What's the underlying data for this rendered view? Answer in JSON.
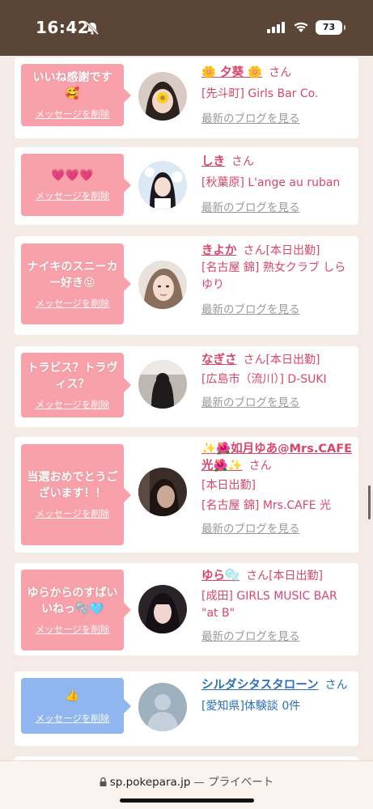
{
  "status_bar": {
    "time": "16:42",
    "battery": "73"
  },
  "browser": {
    "domain": "sp.pokepara.jp",
    "privacy_label": "— プライベート"
  },
  "common": {
    "delete_label": "メッセージを削除",
    "san": "さん",
    "blog_label": "最新のブログを見る"
  },
  "messages": [
    {
      "text": "いいね感謝です🥰",
      "name": "🌼 夕葵 🌼",
      "tag": "",
      "area_shop": "[先斗町] Girls Bar Co.",
      "blog": true,
      "color": "#f9a1aa"
    },
    {
      "text": "💗💗💗",
      "name": "しき",
      "tag": "",
      "area_shop": "[秋葉原] L'ange au ruban",
      "blog": true,
      "color": "#f9a1aa"
    },
    {
      "text": "ナイキのスニーカー好き😝",
      "name": "きよか",
      "tag": "[本日出勤]",
      "area_shop": "[名古屋 錦] 熟女クラブ しらゆり",
      "blog": true,
      "color": "#f9a1aa"
    },
    {
      "text": "トラビス？トラヴィス？",
      "name": "なぎさ",
      "tag": "[本日出勤]",
      "area_shop": "[広島市（流川）] D-SUKI",
      "blog": true,
      "color": "#f9a1aa"
    },
    {
      "text": "当選おめでとうございます！！",
      "name": "✨🌺如月ゆあ@Mrs.CAFE光🌺✨",
      "tag": "[本日出勤]",
      "area_shop": "[名古屋 錦] Mrs.CAFE 光",
      "blog": true,
      "color": "#f9a1aa"
    },
    {
      "text": "ゆらからのすばいいねっ🫧🩵",
      "name": "ゆら🫧",
      "tag": "[本日出勤]",
      "area_shop": "[成田] GIRLS MUSIC BAR \"at B\"",
      "blog": true,
      "color": "#f9a1aa"
    },
    {
      "text": "👍",
      "name": "シルダシタスタローン",
      "tag": "",
      "area_shop": "[愛知県]体験談 0件",
      "blog": false,
      "color": "#8fb6ef"
    }
  ]
}
